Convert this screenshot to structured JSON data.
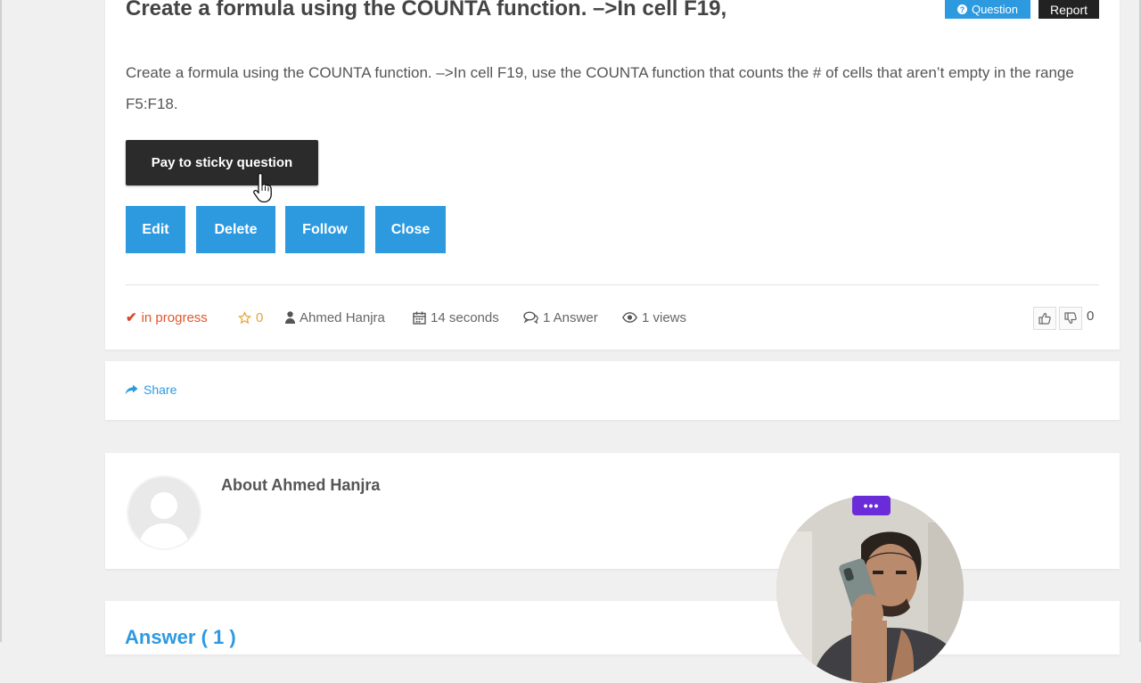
{
  "question": {
    "title": "Create a formula using the COUNTA function. –>In cell F19,",
    "badge_question": "Question",
    "badge_report": "Report",
    "body": "Create a formula using the COUNTA function. –>In cell F19, use the COUNTA function that counts the # of cells that aren’t empty in the range F5:F18.",
    "sticky_button": "Pay to sticky question",
    "actions": {
      "edit": "Edit",
      "delete": "Delete",
      "follow": "Follow",
      "close": "Close"
    },
    "meta": {
      "status": "in progress",
      "favorites": "0",
      "author": "Ahmed Hanjra",
      "time": "14 seconds",
      "answers": "1 Answer",
      "views": "1 views"
    },
    "votes": "0"
  },
  "share": {
    "label": "Share"
  },
  "about": {
    "title": "About Ahmed Hanjra"
  },
  "answers": {
    "title": "Answer ( 1 )"
  },
  "webcam": {
    "menu": "•••"
  },
  "colors": {
    "accent": "#2d9ae0",
    "dark_button": "#2b2b2b",
    "status": "#e0572b",
    "favorite": "#e8a33b",
    "cam_menu": "#6a2bd8"
  }
}
